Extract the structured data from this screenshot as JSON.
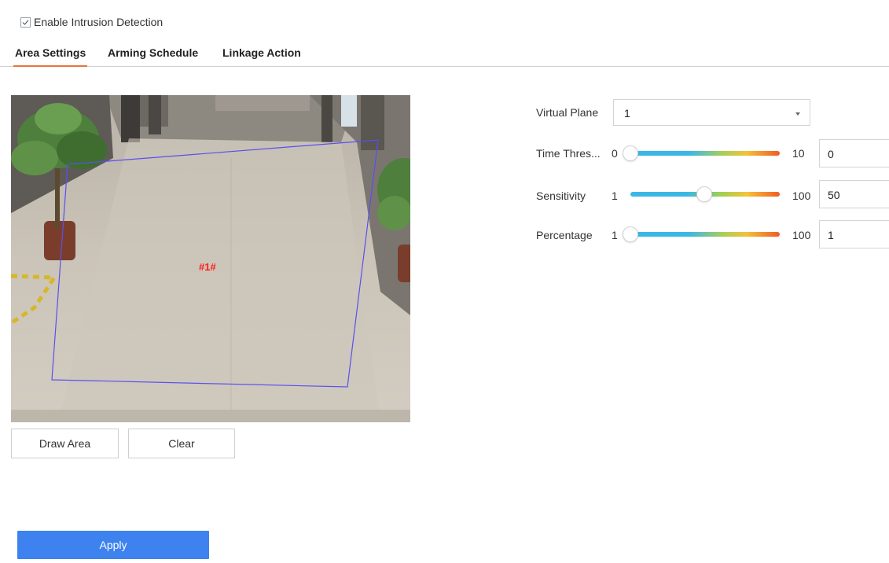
{
  "enable": {
    "label": "Enable Intrusion Detection",
    "checked": true
  },
  "tabs": [
    {
      "label": "Area Settings",
      "active": true
    },
    {
      "label": "Arming Schedule",
      "active": false
    },
    {
      "label": "Linkage Action",
      "active": false
    }
  ],
  "video": {
    "region_label": "#1#",
    "region_color": "#5a4ff0",
    "label_color": "#ff2020"
  },
  "buttons": {
    "draw_area": "Draw Area",
    "clear": "Clear",
    "apply": "Apply"
  },
  "settings": {
    "virtual_plane": {
      "label": "Virtual Plane",
      "value": "1"
    },
    "time_threshold": {
      "label": "Time Thres...",
      "min": "0",
      "max": "10",
      "value": "0"
    },
    "sensitivity": {
      "label": "Sensitivity",
      "min": "1",
      "max": "100",
      "value": "50"
    },
    "percentage": {
      "label": "Percentage",
      "min": "1",
      "max": "100",
      "value": "1"
    }
  },
  "colors": {
    "accent": "#e8743b",
    "apply_button": "#3d82ee"
  }
}
